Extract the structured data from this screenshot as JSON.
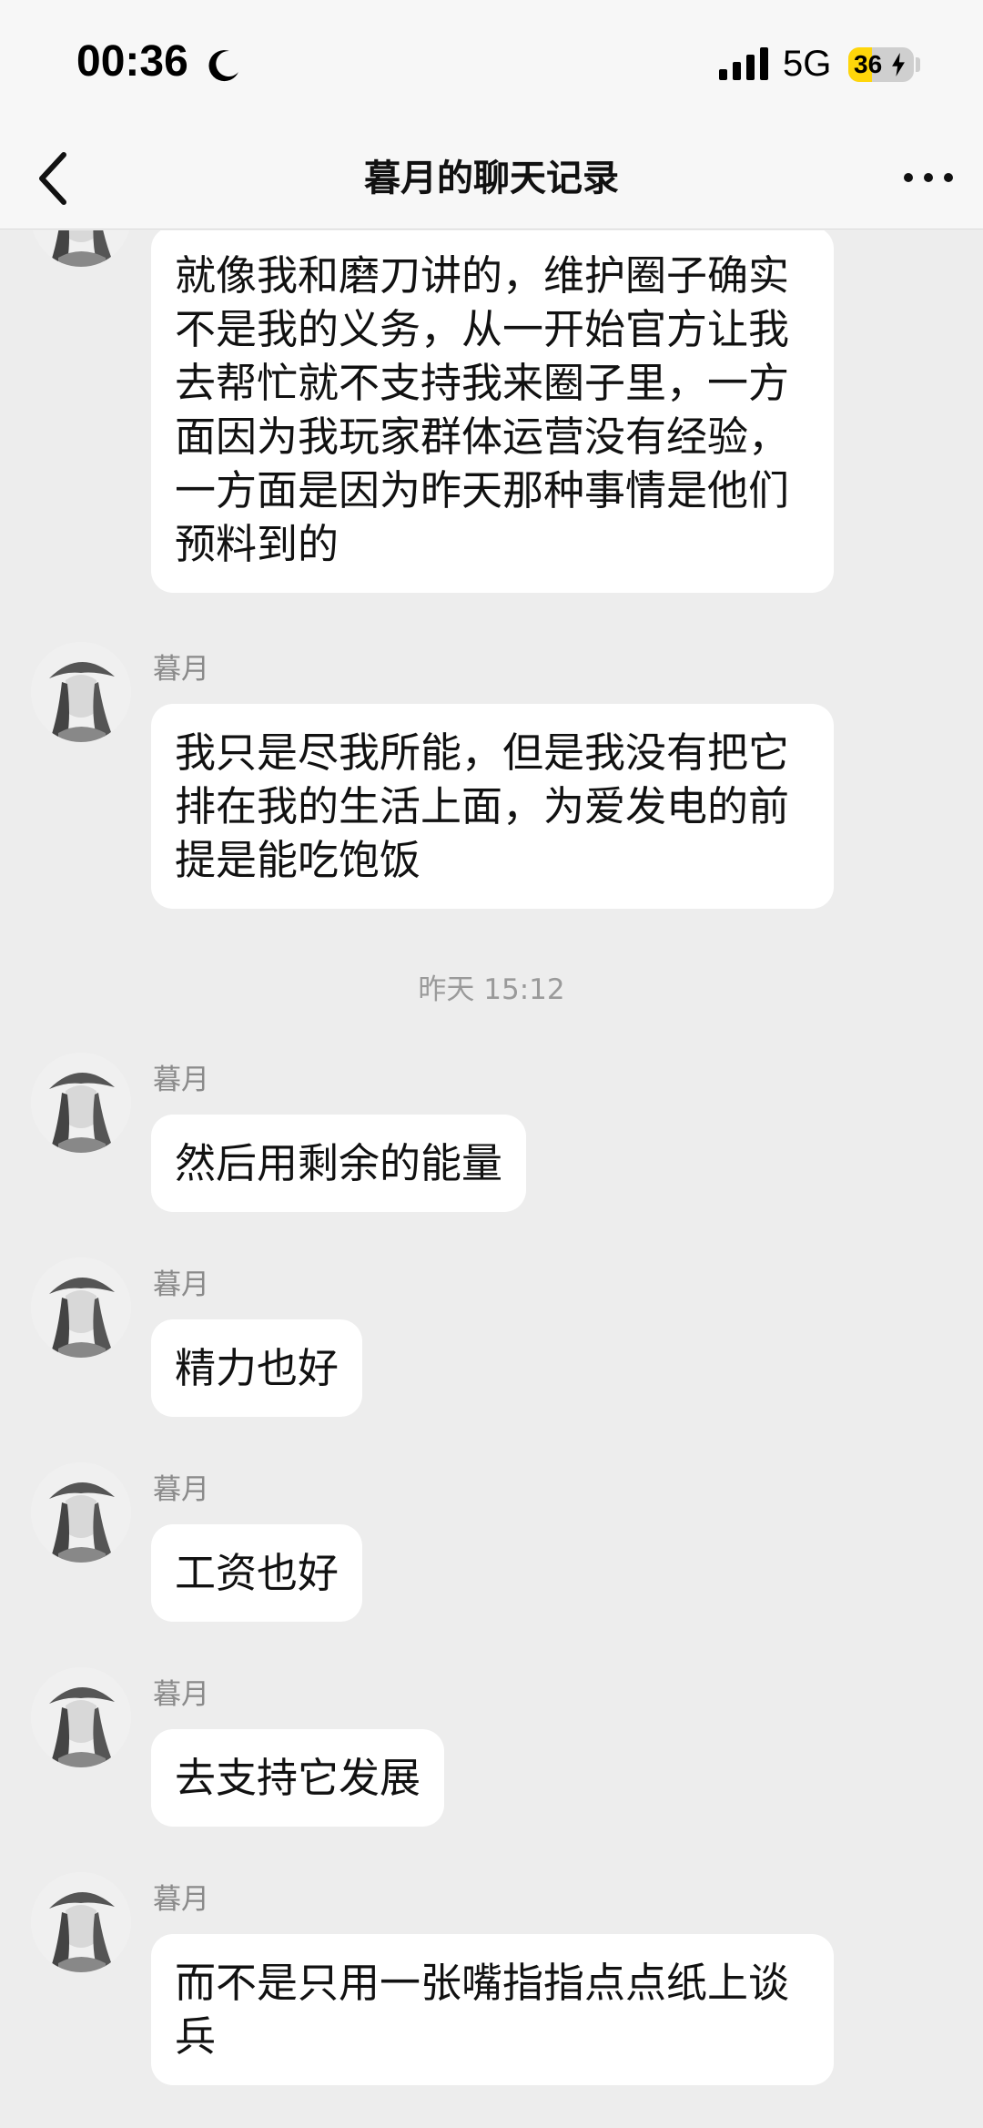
{
  "status_bar": {
    "time": "00:36",
    "network": "5G",
    "battery_level": "36",
    "battery_fraction": 0.36,
    "icons": [
      "moon-icon",
      "signal-icon",
      "battery-icon",
      "charging-icon"
    ]
  },
  "header": {
    "title": "暮月的聊天记录",
    "back_icon": "chevron-left-icon",
    "more_icon": "more-dots-icon"
  },
  "colors": {
    "background": "#ededed",
    "bubble": "#ffffff",
    "battery_accent": "#ffd60a"
  },
  "messages": [
    {
      "text": "就像我和磨刀讲的，维护圈子确实\n不是我的义务，从一开始官方让我\n去帮忙就不支持我来圈子里，一方\n面因为我玩家群体运营没有经验，\n一方面是因为昨天那种事情是他们\n预料到的"
    },
    {
      "sender": "暮月",
      "text": "我只是尽我所能，但是我没有把它\n排在我的生活上面，为爱发电的前\n提是能吃饱饭"
    },
    {
      "timestamp": "昨天 15:12"
    },
    {
      "sender": "暮月",
      "text": "然后用剩余的能量"
    },
    {
      "sender": "暮月",
      "text": "精力也好"
    },
    {
      "sender": "暮月",
      "text": "工资也好"
    },
    {
      "sender": "暮月",
      "text": "去支持它发展"
    },
    {
      "sender": "暮月",
      "text": "而不是只用一张嘴指指点点纸上谈\n兵"
    }
  ]
}
